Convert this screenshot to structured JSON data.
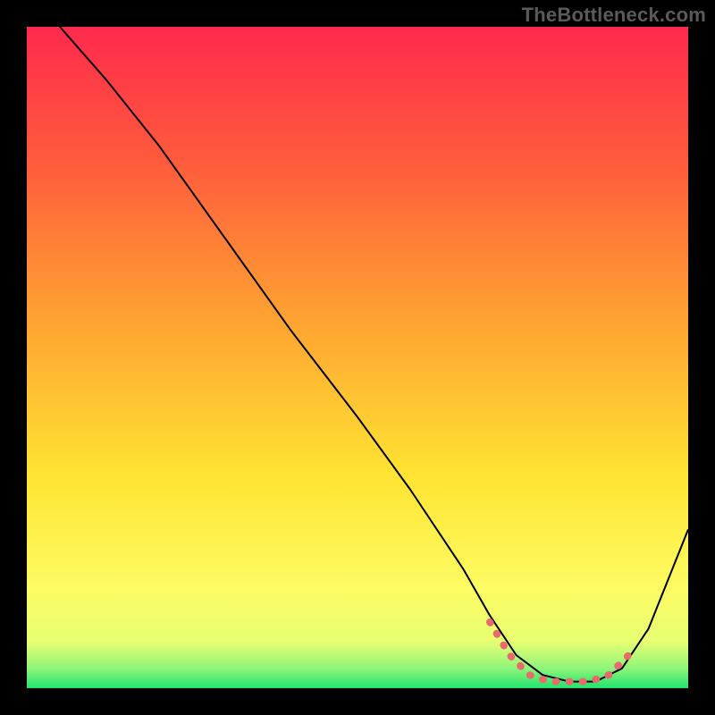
{
  "watermark": "TheBottleneck.com",
  "chart_data": {
    "type": "line",
    "title": "",
    "xlabel": "",
    "ylabel": "",
    "xlim": [
      0,
      100
    ],
    "ylim": [
      0,
      100
    ],
    "grid": false,
    "legend": false,
    "gradient_stops": [
      {
        "offset": 0,
        "color": "#ff2a4d"
      },
      {
        "offset": 20,
        "color": "#ff5a3c"
      },
      {
        "offset": 45,
        "color": "#ffa531"
      },
      {
        "offset": 68,
        "color": "#ffe432"
      },
      {
        "offset": 85,
        "color": "#fdfc63"
      },
      {
        "offset": 93,
        "color": "#e7ff72"
      },
      {
        "offset": 97,
        "color": "#8ff57a"
      },
      {
        "offset": 100,
        "color": "#21e36e"
      }
    ],
    "series": [
      {
        "name": "bottleneck-curve",
        "stroke": "#000000",
        "stroke_width": 2,
        "x": [
          5,
          12,
          20,
          30,
          40,
          50,
          58,
          66,
          70,
          74,
          78,
          82,
          86,
          90,
          94,
          100
        ],
        "y": [
          100,
          92,
          82,
          68,
          54,
          41,
          30,
          18,
          11,
          5,
          2,
          1,
          1,
          3,
          9,
          24
        ]
      },
      {
        "name": "optimal-range-marker",
        "stroke": "#e86a6a",
        "stroke_width": 8,
        "linecap": "round",
        "x": [
          70,
          73,
          76,
          79,
          82,
          85,
          88,
          91
        ],
        "y": [
          10,
          5,
          2,
          1,
          1,
          1,
          2,
          5
        ]
      }
    ]
  }
}
